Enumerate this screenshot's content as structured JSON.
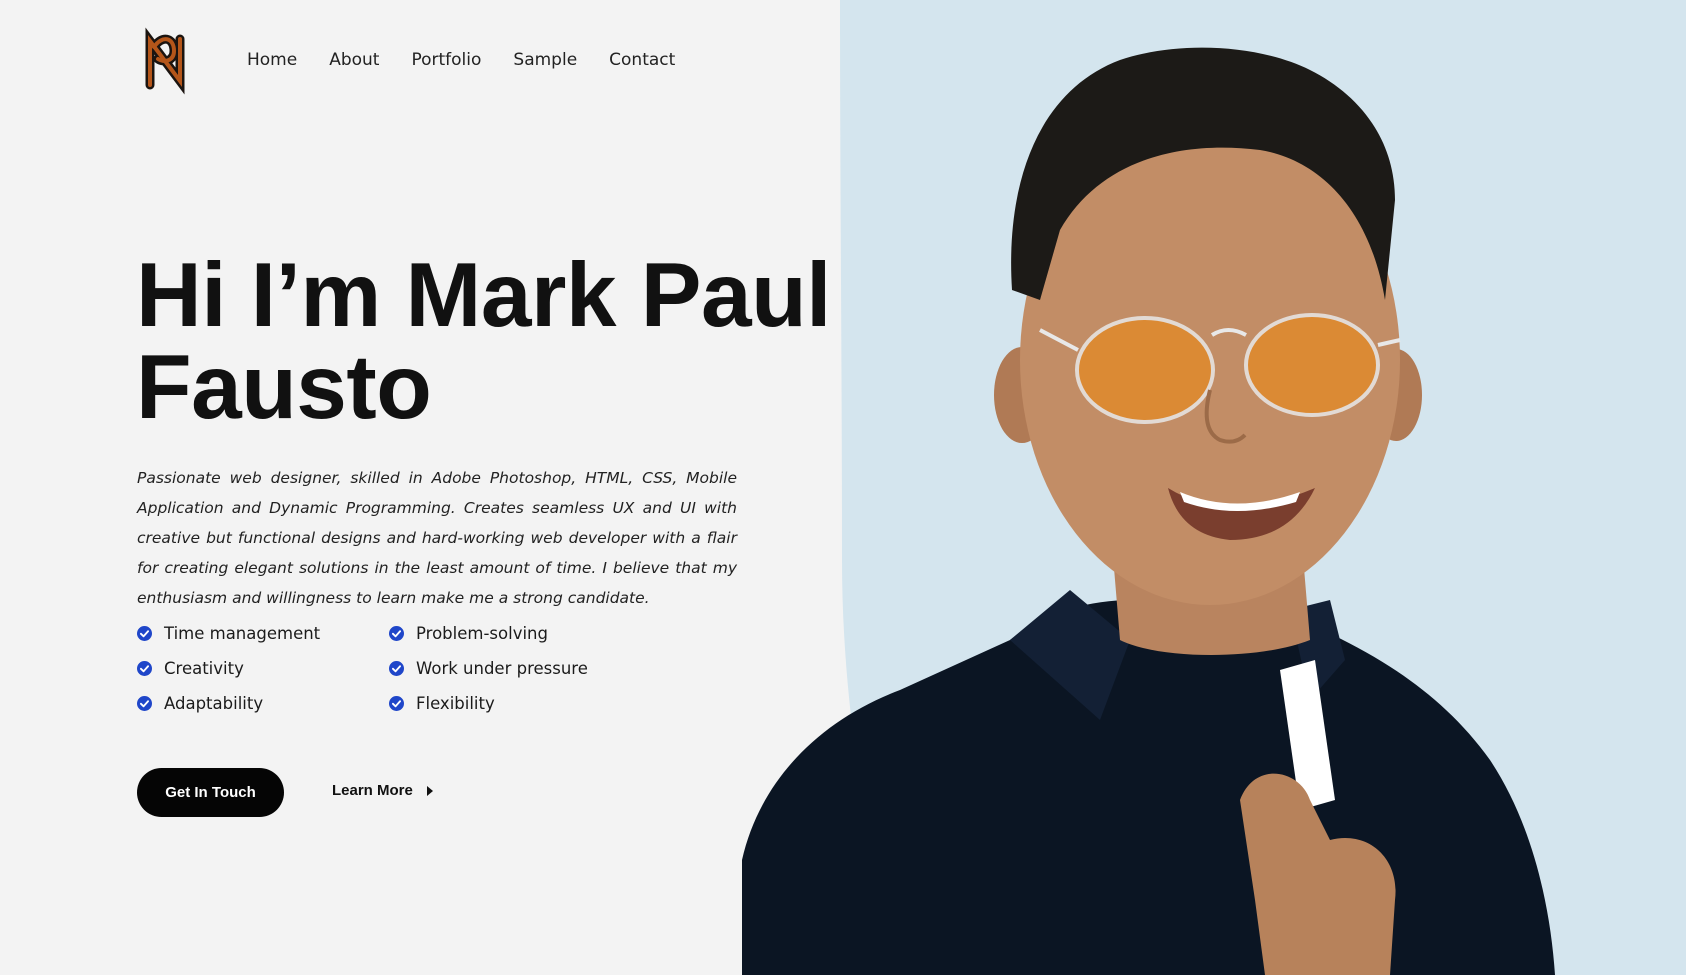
{
  "nav": {
    "items": [
      "Home",
      "About",
      "Portfolio",
      "Sample",
      "Contact"
    ]
  },
  "logo": {
    "icon": "mp-monogram-icon"
  },
  "hero": {
    "title_line1": "Hi I’m Mark Paul",
    "title_line2": "Fausto",
    "intro": "Passionate web designer, skilled in Adobe Photoshop, HTML, CSS, Mobile Application and Dynamic Programming. Creates seamless UX and UI with creative but functional designs and hard-working web developer with a flair for creating elegant solutions in the least amount of time. I believe that my enthusiasm and willingness to learn make me a strong candidate."
  },
  "skills": [
    "Time management",
    "Problem-solving",
    "Creativity",
    "Work under pressure",
    "Adaptability",
    "Flexibility"
  ],
  "buttons": {
    "primary": "Get In Touch",
    "secondary": "Learn More"
  },
  "colors": {
    "background": "#f3f3f3",
    "panel": "#d4e5ee",
    "accent_check": "#1f46c9",
    "button": "#050505"
  }
}
